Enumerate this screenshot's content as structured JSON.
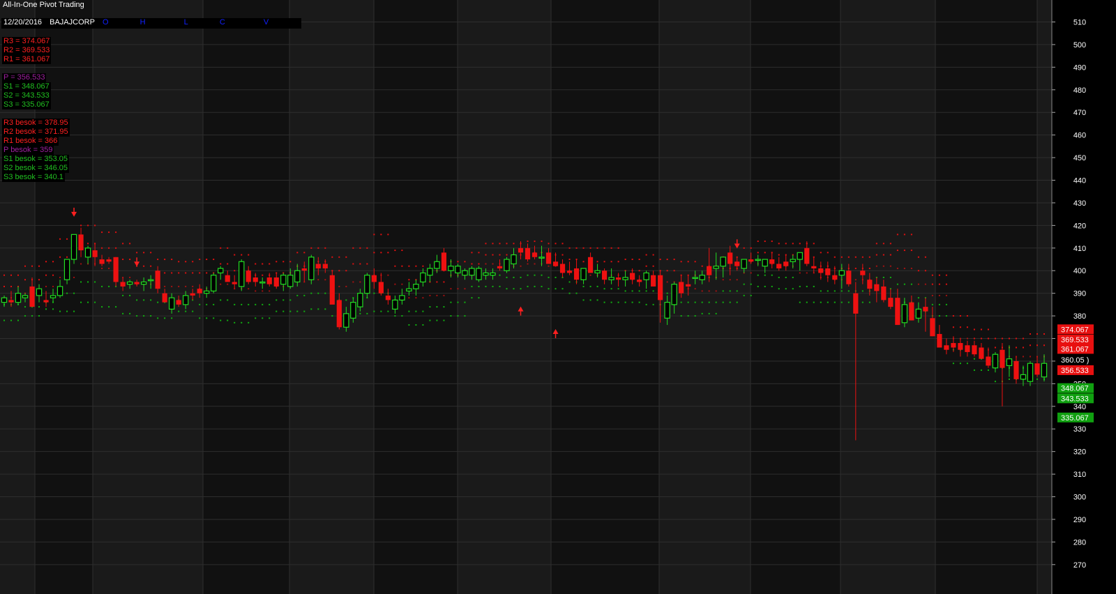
{
  "header": {
    "title": "All-In-One Pivot Trading",
    "date": "12/20/2016",
    "symbol": "BAJAJCORP",
    "ohlcv": [
      "O",
      "H",
      "L",
      "C",
      "V"
    ]
  },
  "pivot_levels": [
    {
      "text": "R3 = 374.067",
      "color": "#ff2020"
    },
    {
      "text": "R2 = 369.533",
      "color": "#ff2020"
    },
    {
      "text": "R1 = 361.067",
      "color": "#ff2020"
    },
    {
      "text": "P   = 356.533",
      "color": "#a020a0"
    },
    {
      "text": "S1 = 348.067",
      "color": "#20c020"
    },
    {
      "text": "S2 = 343.533",
      "color": "#20c020"
    },
    {
      "text": "S3 = 335.067",
      "color": "#20c020"
    }
  ],
  "besok_levels": [
    {
      "text": "R3 besok = 378.95",
      "color": "#ff2020"
    },
    {
      "text": "R2 besok = 371.95",
      "color": "#ff2020"
    },
    {
      "text": "R1 besok = 366",
      "color": "#ff2020"
    },
    {
      "text": "P besok  = 359",
      "color": "#a020a0"
    },
    {
      "text": "S1 besok = 353.05",
      "color": "#20c020"
    },
    {
      "text": "S2 besok = 346.05",
      "color": "#20c020"
    },
    {
      "text": "S3 besok = 340.1",
      "color": "#20c020"
    }
  ],
  "price_tags": [
    {
      "text": "374.067",
      "value": 374.067,
      "bg": "#e81010",
      "fg": "#ffffff"
    },
    {
      "text": "369.533",
      "value": 369.533,
      "bg": "#e81010",
      "fg": "#ffffff"
    },
    {
      "text": "361.067",
      "value": 365.4,
      "bg": "#e81010",
      "fg": "#ffffff"
    },
    {
      "text": "360.05 )",
      "value": 360.6,
      "bg": "#000000",
      "fg": "#ffffff"
    },
    {
      "text": "356.533",
      "value": 356.0,
      "bg": "#e81010",
      "fg": "#ffffff"
    },
    {
      "text": "348.067",
      "value": 348.067,
      "bg": "#10a010",
      "fg": "#ffffff"
    },
    {
      "text": "343.533",
      "value": 343.533,
      "bg": "#10a010",
      "fg": "#ffffff"
    },
    {
      "text": "335.067",
      "value": 335.067,
      "bg": "#10a010",
      "fg": "#ffffff"
    }
  ],
  "colors": {
    "background": "#000000",
    "band_light": "#1a1a1a",
    "band_dark": "#111111",
    "grid": "#2e2e2e",
    "bull": "#22dd22",
    "bear": "#ee1111",
    "resistance_dot": "#e01010",
    "support_dot": "#10b010",
    "arrow": "#ff2020",
    "axis_text": "#ffffff"
  },
  "chart_data": {
    "type": "candlestick",
    "title": "All-In-One Pivot Trading",
    "ylim": [
      265,
      515
    ],
    "y_ticks": [
      270,
      280,
      290,
      300,
      310,
      320,
      330,
      340,
      350,
      360,
      370,
      380,
      390,
      400,
      410,
      420,
      430,
      440,
      450,
      460,
      470,
      480,
      490,
      500,
      510
    ],
    "grid": true,
    "candles": [
      [
        386,
        389,
        384,
        388
      ],
      [
        387,
        391,
        384,
        386
      ],
      [
        386,
        393,
        385,
        390
      ],
      [
        388,
        390,
        386,
        389
      ],
      [
        393,
        397,
        384,
        384
      ],
      [
        389,
        394,
        386,
        392
      ],
      [
        387,
        391,
        384,
        386
      ],
      [
        388,
        392,
        386,
        389
      ],
      [
        389,
        396,
        388,
        393
      ],
      [
        396,
        405,
        394,
        405
      ],
      [
        405,
        412,
        403,
        416
      ],
      [
        416,
        419,
        406,
        409
      ],
      [
        406,
        411,
        403,
        410
      ],
      [
        409,
        412,
        402,
        406
      ],
      [
        405,
        407,
        402,
        403
      ],
      [
        405,
        406,
        403,
        404
      ],
      [
        406,
        406,
        393,
        395
      ],
      [
        395,
        397,
        391,
        393
      ],
      [
        394,
        396,
        392,
        395
      ],
      [
        395,
        396,
        393,
        394
      ],
      [
        394,
        397,
        391,
        395
      ],
      [
        396,
        398,
        392,
        396
      ],
      [
        400,
        402,
        390,
        392
      ],
      [
        390,
        392,
        386,
        386
      ],
      [
        383,
        390,
        381,
        388
      ],
      [
        387,
        389,
        384,
        385
      ],
      [
        385,
        391,
        383,
        389
      ],
      [
        390,
        392,
        387,
        389
      ],
      [
        392,
        394,
        388,
        390
      ],
      [
        390,
        393,
        388,
        391
      ],
      [
        391,
        399,
        390,
        398
      ],
      [
        399,
        402,
        396,
        401
      ],
      [
        398,
        400,
        395,
        395
      ],
      [
        395,
        398,
        392,
        394
      ],
      [
        393,
        405,
        391,
        404
      ],
      [
        400,
        402,
        394,
        395
      ],
      [
        397,
        399,
        393,
        395
      ],
      [
        395,
        397,
        392,
        395
      ],
      [
        397,
        399,
        393,
        394
      ],
      [
        397,
        399,
        392,
        393
      ],
      [
        394,
        399,
        391,
        398
      ],
      [
        393,
        401,
        392,
        398
      ],
      [
        395,
        403,
        393,
        400
      ],
      [
        401,
        404,
        395,
        400
      ],
      [
        396,
        407,
        394,
        406
      ],
      [
        403,
        406,
        398,
        401
      ],
      [
        403,
        405,
        399,
        401
      ],
      [
        398,
        400,
        387,
        385
      ],
      [
        387,
        390,
        374,
        375
      ],
      [
        375,
        384,
        373,
        381
      ],
      [
        379,
        388,
        377,
        386
      ],
      [
        384,
        392,
        382,
        390
      ],
      [
        390,
        399,
        388,
        398
      ],
      [
        398,
        401,
        392,
        395
      ],
      [
        395,
        399,
        389,
        390
      ],
      [
        389,
        392,
        385,
        387
      ],
      [
        383,
        389,
        381,
        387
      ],
      [
        387,
        392,
        385,
        389
      ],
      [
        391,
        395,
        389,
        392
      ],
      [
        392,
        396,
        389,
        394
      ],
      [
        395,
        401,
        393,
        399
      ],
      [
        398,
        403,
        395,
        401
      ],
      [
        401,
        407,
        399,
        404
      ],
      [
        408,
        410,
        400,
        400
      ],
      [
        400,
        405,
        397,
        402
      ],
      [
        399,
        403,
        397,
        402
      ],
      [
        398,
        401,
        396,
        400
      ],
      [
        398,
        402,
        396,
        401
      ],
      [
        396,
        402,
        395,
        401
      ],
      [
        398,
        401,
        396,
        399
      ],
      [
        398,
        401,
        396,
        399
      ],
      [
        402,
        405,
        400,
        401
      ],
      [
        400,
        406,
        399,
        405
      ],
      [
        403,
        410,
        401,
        407
      ],
      [
        410,
        413,
        405,
        408
      ],
      [
        410,
        412,
        404,
        405
      ],
      [
        408,
        411,
        405,
        406
      ],
      [
        406,
        411,
        402,
        406
      ],
      [
        408,
        410,
        403,
        403
      ],
      [
        404,
        408,
        402,
        402
      ],
      [
        403,
        405,
        397,
        399
      ],
      [
        400,
        404,
        398,
        399
      ],
      [
        401,
        405,
        394,
        396
      ],
      [
        396,
        400,
        394,
        401
      ],
      [
        406,
        408,
        399,
        399
      ],
      [
        399,
        403,
        397,
        400
      ],
      [
        400,
        401,
        394,
        396
      ],
      [
        396,
        401,
        394,
        397
      ],
      [
        397,
        399,
        393,
        396
      ],
      [
        396,
        400,
        393,
        397
      ],
      [
        399,
        401,
        394,
        396
      ],
      [
        396,
        398,
        393,
        395
      ],
      [
        396,
        400,
        392,
        399
      ],
      [
        398,
        400,
        393,
        393
      ],
      [
        398,
        400,
        377,
        387
      ],
      [
        379,
        389,
        376,
        386
      ],
      [
        385,
        395,
        381,
        394
      ],
      [
        395,
        398,
        388,
        390
      ],
      [
        394,
        398,
        389,
        393
      ],
      [
        397,
        400,
        394,
        397
      ],
      [
        396,
        400,
        394,
        398
      ],
      [
        402,
        410,
        395,
        398
      ],
      [
        401,
        408,
        396,
        402
      ],
      [
        402,
        405,
        397,
        406
      ],
      [
        408,
        411,
        398,
        403
      ],
      [
        404,
        406,
        400,
        402
      ],
      [
        401,
        405,
        399,
        405
      ],
      [
        405,
        408,
        403,
        404
      ],
      [
        405,
        407,
        402,
        405
      ],
      [
        402,
        405,
        399,
        405
      ],
      [
        405,
        408,
        401,
        403
      ],
      [
        403,
        406,
        400,
        401
      ],
      [
        404,
        407,
        400,
        402
      ],
      [
        404,
        407,
        401,
        405
      ],
      [
        405,
        408,
        400,
        408
      ],
      [
        410,
        413,
        402,
        403
      ],
      [
        402,
        406,
        399,
        401
      ],
      [
        401,
        404,
        396,
        399
      ],
      [
        401,
        404,
        395,
        398
      ],
      [
        398,
        402,
        394,
        396
      ],
      [
        398,
        403,
        392,
        400
      ],
      [
        400,
        403,
        393,
        394
      ],
      [
        390,
        395,
        325,
        381
      ],
      [
        400,
        403,
        394,
        398
      ],
      [
        396,
        399,
        389,
        392
      ],
      [
        394,
        397,
        386,
        391
      ],
      [
        393,
        396,
        386,
        387
      ],
      [
        388,
        392,
        383,
        384
      ],
      [
        388,
        392,
        376,
        376
      ],
      [
        377,
        388,
        375,
        385
      ],
      [
        386,
        389,
        378,
        378
      ],
      [
        379,
        386,
        377,
        383
      ],
      [
        384,
        388,
        373,
        382
      ],
      [
        379,
        384,
        371,
        371
      ],
      [
        372,
        376,
        366,
        366
      ],
      [
        367,
        370,
        363,
        365
      ],
      [
        368,
        371,
        364,
        366
      ],
      [
        368,
        370,
        362,
        365
      ],
      [
        367,
        369,
        362,
        364
      ],
      [
        367,
        369,
        362,
        363
      ],
      [
        366,
        368,
        361,
        361
      ],
      [
        362,
        366,
        357,
        358
      ],
      [
        357,
        364,
        355,
        363
      ],
      [
        365,
        368,
        340,
        357
      ],
      [
        358,
        367,
        353,
        361
      ],
      [
        360,
        362,
        350,
        352
      ],
      [
        352,
        358,
        349,
        354
      ],
      [
        351,
        360,
        349,
        359
      ],
      [
        359,
        362,
        353,
        354
      ],
      [
        353,
        363,
        351,
        359
      ]
    ],
    "pivot_dots": [
      [
        398,
        393,
        388,
        385,
        378
      ],
      [
        402,
        396,
        390,
        384,
        380
      ],
      [
        404,
        398,
        393,
        386,
        383
      ],
      [
        414,
        406,
        397,
        390,
        382
      ],
      [
        420,
        412,
        403,
        395,
        386
      ],
      [
        417,
        410,
        401,
        393,
        384
      ],
      [
        412,
        405,
        397,
        389,
        381
      ],
      [
        408,
        402,
        394,
        387,
        380
      ],
      [
        405,
        399,
        393,
        386,
        379
      ],
      [
        404,
        399,
        393,
        387,
        382
      ],
      [
        405,
        399,
        392,
        385,
        379
      ],
      [
        410,
        403,
        394,
        387,
        378
      ],
      [
        407,
        400,
        392,
        385,
        377
      ],
      [
        403,
        398,
        391,
        385,
        379
      ],
      [
        404,
        399,
        393,
        387,
        382
      ],
      [
        408,
        402,
        395,
        389,
        382
      ],
      [
        410,
        404,
        396,
        390,
        383
      ],
      [
        406,
        400,
        393,
        387,
        380
      ],
      [
        410,
        403,
        395,
        388,
        381
      ],
      [
        416,
        408,
        398,
        390,
        382
      ],
      [
        409,
        402,
        394,
        387,
        380
      ],
      [
        402,
        396,
        388,
        382,
        376
      ],
      [
        400,
        395,
        389,
        384,
        378
      ],
      [
        404,
        398,
        392,
        386,
        380
      ],
      [
        408,
        403,
        398,
        393,
        388
      ],
      [
        412,
        407,
        403,
        398,
        393
      ],
      [
        412,
        407,
        402,
        397,
        392
      ],
      [
        413,
        408,
        403,
        398,
        393
      ],
      [
        412,
        407,
        402,
        397,
        392
      ],
      [
        410,
        405,
        400,
        395,
        390
      ],
      [
        410,
        404,
        398,
        393,
        387
      ],
      [
        410,
        404,
        398,
        392,
        386
      ],
      [
        405,
        400,
        396,
        391,
        386
      ],
      [
        407,
        402,
        396,
        391,
        385
      ],
      [
        405,
        400,
        395,
        390,
        385
      ],
      [
        404,
        398,
        392,
        386,
        380
      ],
      [
        402,
        397,
        391,
        386,
        381
      ],
      [
        406,
        401,
        396,
        391,
        386
      ],
      [
        410,
        404,
        399,
        394,
        389
      ],
      [
        413,
        408,
        403,
        398,
        393
      ],
      [
        412,
        407,
        402,
        397,
        392
      ],
      [
        412,
        406,
        399,
        393,
        386
      ],
      [
        408,
        402,
        397,
        391,
        386
      ],
      [
        406,
        401,
        396,
        391,
        386
      ],
      [
        406,
        401,
        396,
        391,
        386
      ],
      [
        412,
        407,
        402,
        397,
        392
      ],
      [
        416,
        409,
        401,
        394,
        386
      ],
      [
        406,
        400,
        394,
        388,
        382
      ],
      [
        398,
        394,
        389,
        385,
        380
      ],
      [
        380,
        375,
        370,
        365,
        359
      ],
      [
        374,
        370,
        365,
        361,
        356
      ],
      [
        370,
        366,
        361,
        357,
        351
      ],
      [
        370,
        366,
        362,
        357,
        352
      ],
      [
        372,
        367,
        362,
        357,
        352
      ]
    ],
    "arrows": [
      {
        "i": 10,
        "dir": "down",
        "y": 426
      },
      {
        "i": 19,
        "dir": "down",
        "y": 404
      },
      {
        "i": 74,
        "dir": "up",
        "y": 382
      },
      {
        "i": 79,
        "dir": "up",
        "y": 372
      },
      {
        "i": 105,
        "dir": "down",
        "y": 412
      }
    ]
  }
}
